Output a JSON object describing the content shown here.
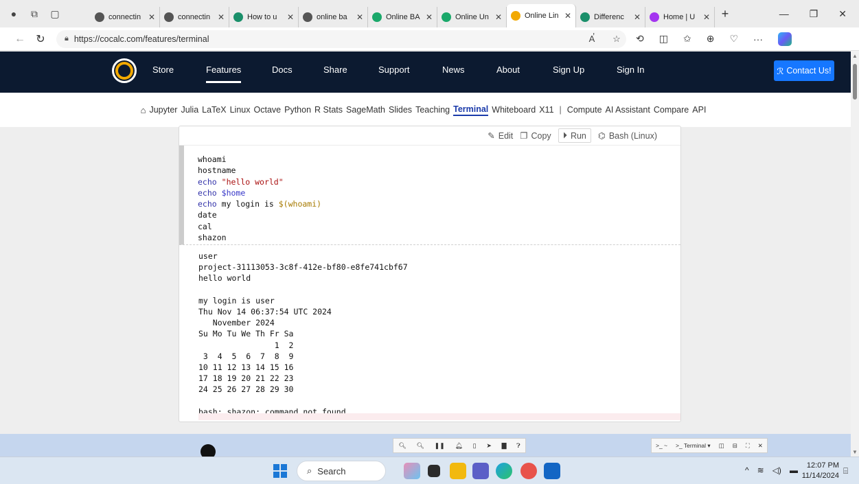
{
  "browser": {
    "tabs": [
      {
        "title": "connectin",
        "fav": "search-favicon",
        "color": "#555555"
      },
      {
        "title": "connectin",
        "fav": "search-favicon",
        "color": "#555555"
      },
      {
        "title": "How to u",
        "fav": "bing-favicon",
        "color": "#1a8f6a"
      },
      {
        "title": "online ba",
        "fav": "search-favicon",
        "color": "#555555"
      },
      {
        "title": "Online BA",
        "fav": "onecompiler-favicon",
        "color": "#1aa86a"
      },
      {
        "title": "Online Un",
        "fav": "onecompiler-favicon",
        "color": "#1aa86a"
      },
      {
        "title": "Online Lin",
        "fav": "cocalc-favicon",
        "color": "#f2a900",
        "active": true
      },
      {
        "title": "Differenc",
        "fav": "bing-favicon",
        "color": "#1a8f6a"
      },
      {
        "title": "Home | U",
        "fav": "udemy-favicon",
        "color": "#a435f0"
      }
    ],
    "url": "https://cocalc.com/features/terminal"
  },
  "site": {
    "nav": {
      "store": "Store",
      "features": "Features",
      "docs": "Docs",
      "share": "Share",
      "support": "Support",
      "news": "News",
      "about": "About",
      "signup": "Sign Up",
      "signin": "Sign In",
      "contact": "Contact Us!"
    },
    "subnav": [
      "Jupyter",
      "Julia",
      "LaTeX",
      "Linux",
      "Octave",
      "Python",
      "R Stats",
      "SageMath",
      "Slides",
      "Teaching",
      "Terminal",
      "Whiteboard",
      "X11"
    ],
    "subnav_active": "Terminal",
    "subnav_right": [
      "Compute",
      "AI Assistant",
      "Compare",
      "API"
    ]
  },
  "card": {
    "edit": "Edit",
    "copy": "Copy",
    "run": "Run",
    "lang": "Bash (Linux)",
    "input_lines": {
      "l1": "whoami",
      "l2": "hostname",
      "l3_cmd": "echo",
      "l3_str": "\"hello world\"",
      "l4_cmd": "echo",
      "l4_var": "$home",
      "l5_cmd": "echo",
      "l5_text": "my login is",
      "l5_sub": "$(whoami)",
      "l6": "date",
      "l7": "cal",
      "l8": "shazon"
    },
    "output": "user\nproject-31113053-3c8f-412e-bf80-e8fe741cbf67\nhello world\n\nmy login is user\nThu Nov 14 06:37:54 UTC 2024\n   November 2024\nSu Mo Tu We Th Fr Sa\n                1  2\n 3  4  5  6  7  8  9\n10 11 12 13 14 15 16\n17 18 19 20 21 22 23\n24 25 26 27 28 29 30\n\nbash: shazon: command not found"
  },
  "dock_right": {
    "term1": ">_ ~",
    "term2": ">_ Terminal ▾"
  },
  "taskbar": {
    "search": "Search",
    "time": "12:07 PM",
    "date": "11/14/2024"
  }
}
